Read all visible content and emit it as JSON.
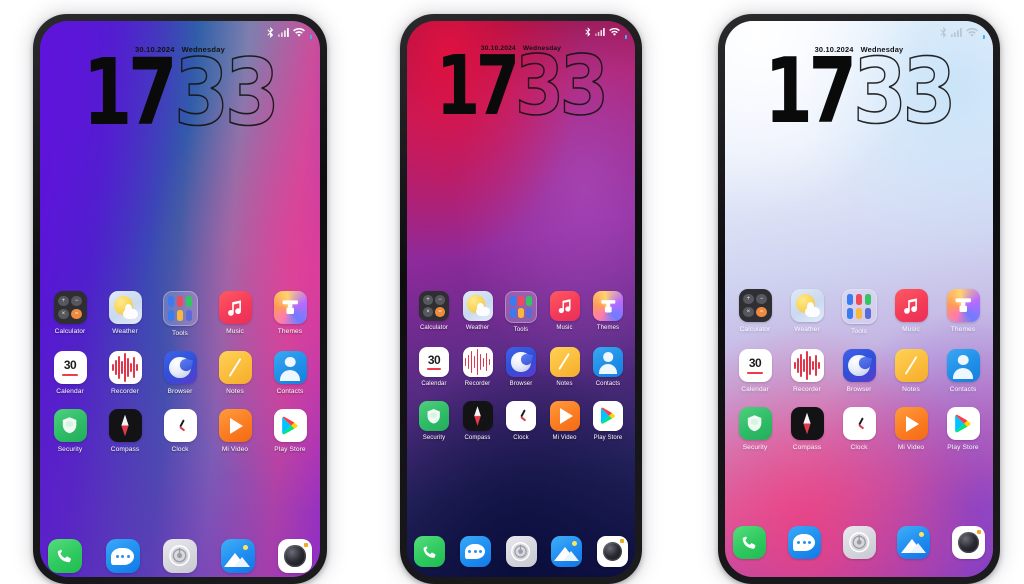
{
  "scene": {
    "title": "Three smartphone home screens with MIUI-style theme",
    "background_color": "#ffffff"
  },
  "widget": {
    "date": "30.10.2024",
    "weekday": "Wednesday",
    "hours": "17",
    "minutes": "33"
  },
  "status_bar": {
    "icons": [
      "bluetooth-icon",
      "cellular-signal-icon",
      "wifi-icon",
      "battery-icon"
    ],
    "battery_color": "#35b6f2"
  },
  "apps": {
    "row1": [
      {
        "label": "Calculator",
        "icon": "calculator-icon"
      },
      {
        "label": "Weather",
        "icon": "weather-icon"
      },
      {
        "label": "Tools",
        "icon": "tools-folder-icon"
      },
      {
        "label": "Music",
        "icon": "music-icon"
      },
      {
        "label": "Themes",
        "icon": "themes-icon"
      }
    ],
    "row2": [
      {
        "label": "Calendar",
        "icon": "calendar-icon",
        "day": "30"
      },
      {
        "label": "Recorder",
        "icon": "recorder-icon"
      },
      {
        "label": "Browser",
        "icon": "browser-icon"
      },
      {
        "label": "Notes",
        "icon": "notes-icon"
      },
      {
        "label": "Contacts",
        "icon": "contacts-icon"
      }
    ],
    "row3": [
      {
        "label": "Security",
        "icon": "security-icon"
      },
      {
        "label": "Compass",
        "icon": "compass-icon"
      },
      {
        "label": "Clock",
        "icon": "clock-icon"
      },
      {
        "label": "Mi Video",
        "icon": "mi-video-icon"
      },
      {
        "label": "Play Store",
        "icon": "play-store-icon"
      }
    ],
    "dock": [
      {
        "label": "Phone",
        "icon": "phone-icon"
      },
      {
        "label": "Messages",
        "icon": "messages-icon"
      },
      {
        "label": "Settings",
        "icon": "settings-icon"
      },
      {
        "label": "Gallery",
        "icon": "gallery-icon"
      },
      {
        "label": "Camera",
        "icon": "camera-icon"
      }
    ]
  },
  "phones": [
    {
      "name": "phone-left",
      "wallpaper": "purple-blue-pink-gradient"
    },
    {
      "name": "phone-center",
      "wallpaper": "crimson-magenta-navy-gradient"
    },
    {
      "name": "phone-right",
      "wallpaper": "white-blue-pink-violet-gradient"
    }
  ]
}
